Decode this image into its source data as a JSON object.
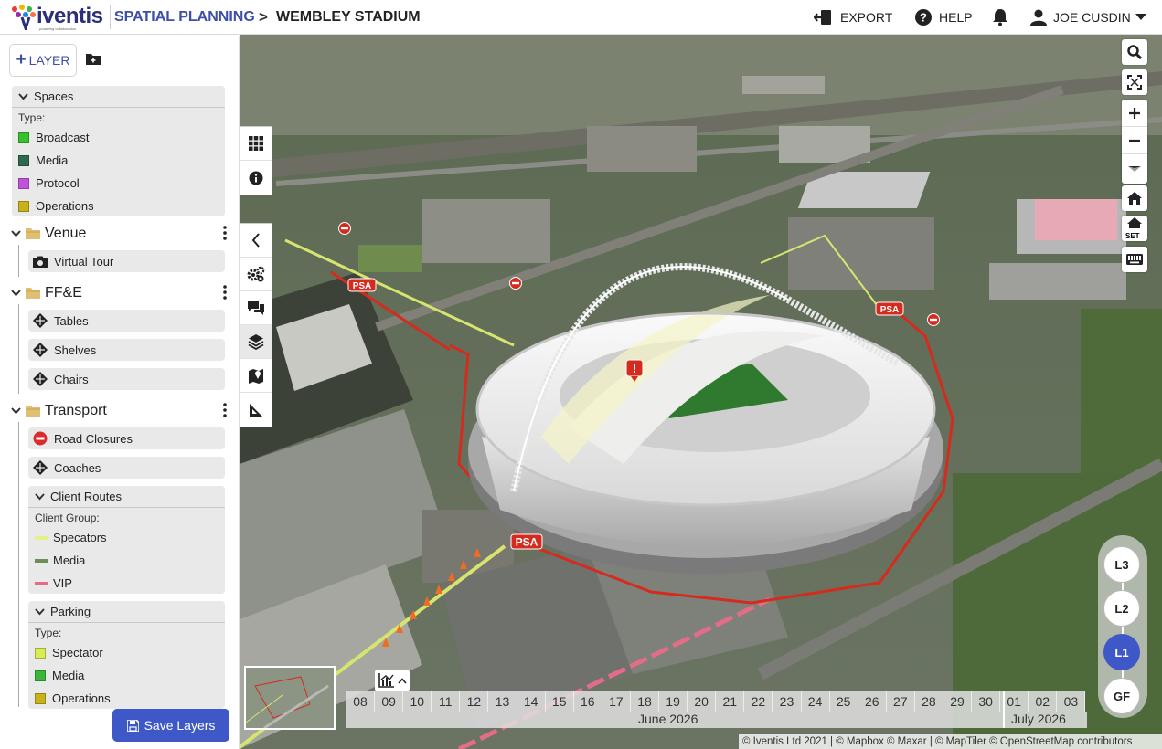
{
  "header": {
    "logo_text": "iventis",
    "logo_tagline": "powering collaboration",
    "crumb_project": "SPATIAL PLANNING",
    "crumb_separator": ">",
    "crumb_page": "WEMBLEY STADIUM",
    "export_label": "EXPORT",
    "help_label": "HELP",
    "user_name": "JOE CUSDIN"
  },
  "sidebar": {
    "add_layer_label": "LAYER",
    "spaces": {
      "title": "Spaces",
      "subtitle": "Type:",
      "items": [
        {
          "label": "Broadcast",
          "color": "#37c22d"
        },
        {
          "label": "Media",
          "color": "#2f6a4c"
        },
        {
          "label": "Protocol",
          "color": "#c054d8"
        },
        {
          "label": "Operations",
          "color": "#c9b11a"
        }
      ]
    },
    "venue": {
      "title": "Venue",
      "items": [
        "Virtual Tour"
      ]
    },
    "ffe": {
      "title": "FF&E",
      "items": [
        "Tables",
        "Shelves",
        "Chairs"
      ]
    },
    "transport": {
      "title": "Transport",
      "items": [
        "Road Closures",
        "Coaches"
      ],
      "client_routes": {
        "title": "Client Routes",
        "subtitle": "Client Group:",
        "items": [
          {
            "label": "Specators",
            "color": "#e5f087"
          },
          {
            "label": "Media",
            "color": "#6a8f56"
          },
          {
            "label": "VIP",
            "color": "#e36c86"
          }
        ]
      },
      "parking": {
        "title": "Parking",
        "subtitle": "Type:",
        "items": [
          {
            "label": "Spectator",
            "color": "#d9ec53"
          },
          {
            "label": "Media",
            "color": "#3ab63b"
          },
          {
            "label": "Operations",
            "color": "#c9b11a"
          }
        ]
      }
    },
    "save_label": "Save Layers"
  },
  "map": {
    "psa_label": "PSA",
    "levels": [
      "L3",
      "L2",
      "L1",
      "GF"
    ],
    "active_level": "L1",
    "timeline": {
      "days": [
        "08",
        "09",
        "10",
        "11",
        "12",
        "13",
        "14",
        "15",
        "16",
        "17",
        "18",
        "19",
        "20",
        "21",
        "22",
        "23",
        "24",
        "25",
        "26",
        "27",
        "28",
        "29",
        "30",
        "01",
        "02",
        "03"
      ],
      "month1": "June 2026",
      "month2": "July 2026"
    },
    "attribution": "© Iventis Ltd 2021 | © Mapbox © Maxar | © MapTiler © OpenStreetMap contributors"
  }
}
